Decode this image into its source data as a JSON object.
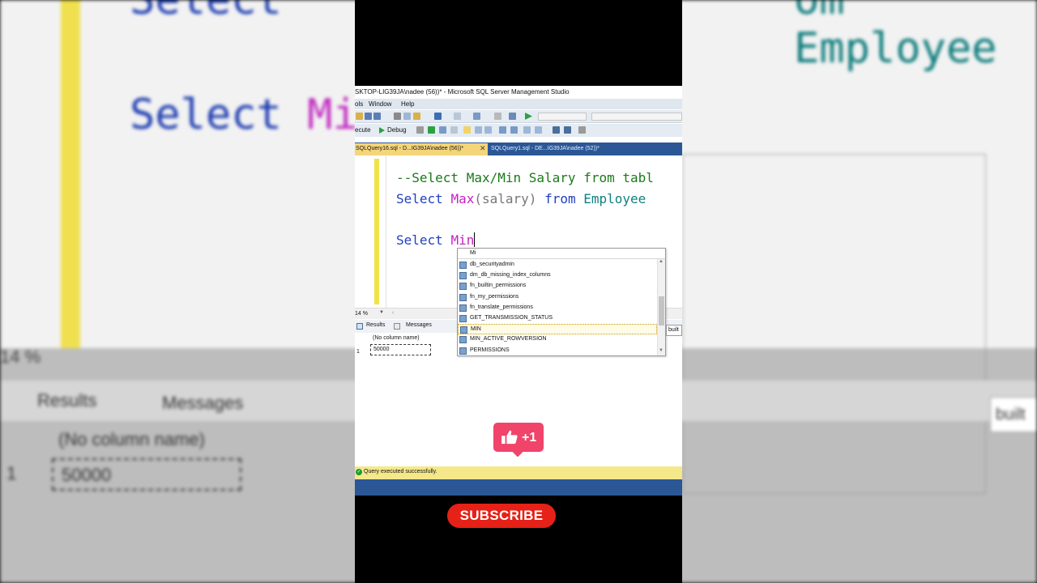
{
  "window": {
    "title": "SKTOP-LIG39JA\\nadee (56))* - Microsoft SQL Server Management Studio"
  },
  "menu": [
    "ols",
    "Window",
    "Help"
  ],
  "toolbar": {
    "execute_label": "ecute",
    "debug_label": "Debug"
  },
  "tabs": [
    {
      "label": "SQLQuery16.sql - D...IG39JA\\nadee (56))*",
      "active": true
    },
    {
      "label": "SQLQuery1.sql - DE...IG39JA\\nadee (52))*",
      "active": false
    }
  ],
  "editor": {
    "line1": "--Select Max/Min Salary from tabl",
    "line2": {
      "kw1": "Select",
      "fn": "Max",
      "open": "(",
      "arg": "salary",
      "close": ")",
      "kw2": "from",
      "obj": "Employee"
    },
    "line3": {
      "kw": "Select",
      "typed": "Min"
    }
  },
  "zoom": "14 %",
  "results_tabs": [
    "Results",
    "Messages"
  ],
  "results_grid": {
    "header": "(No column name)",
    "rows": [
      {
        "num": "1",
        "value": "50000"
      }
    ]
  },
  "autocomplete": {
    "input": "Mi",
    "items": [
      "db_securityadmin",
      "dm_db_missing_index_columns",
      "fn_builtin_permissions",
      "fn_my_permissions",
      "fn_translate_permissions",
      "GET_TRANSMISSION_STATUS",
      "MIN",
      "MIN_ACTIVE_ROWVERSION",
      "PERMISSIONS"
    ],
    "selected_index": 6,
    "tooltip": "built"
  },
  "status": "Query executed successfully.",
  "overlays": {
    "like_count": "+1",
    "subscribe": "SUBSCRIBE"
  },
  "background": {
    "code_kw": "Select",
    "code_fn": "Mi",
    "top_kw": "Select",
    "top_obj": "om Employee",
    "zoom": "14 %",
    "results": "Results",
    "messages": "Messages",
    "colname": "(No column name)",
    "row": "1",
    "cell": "50000",
    "built": "built"
  },
  "colors": {
    "tab_strip": "#2b5797",
    "active_tab": "#f5d57a",
    "comment": "#1a7a1a",
    "keyword": "#1f3fc0",
    "function": "#c61fc6",
    "object": "#108080",
    "like": "#f0446a",
    "subscribe": "#e62117"
  }
}
